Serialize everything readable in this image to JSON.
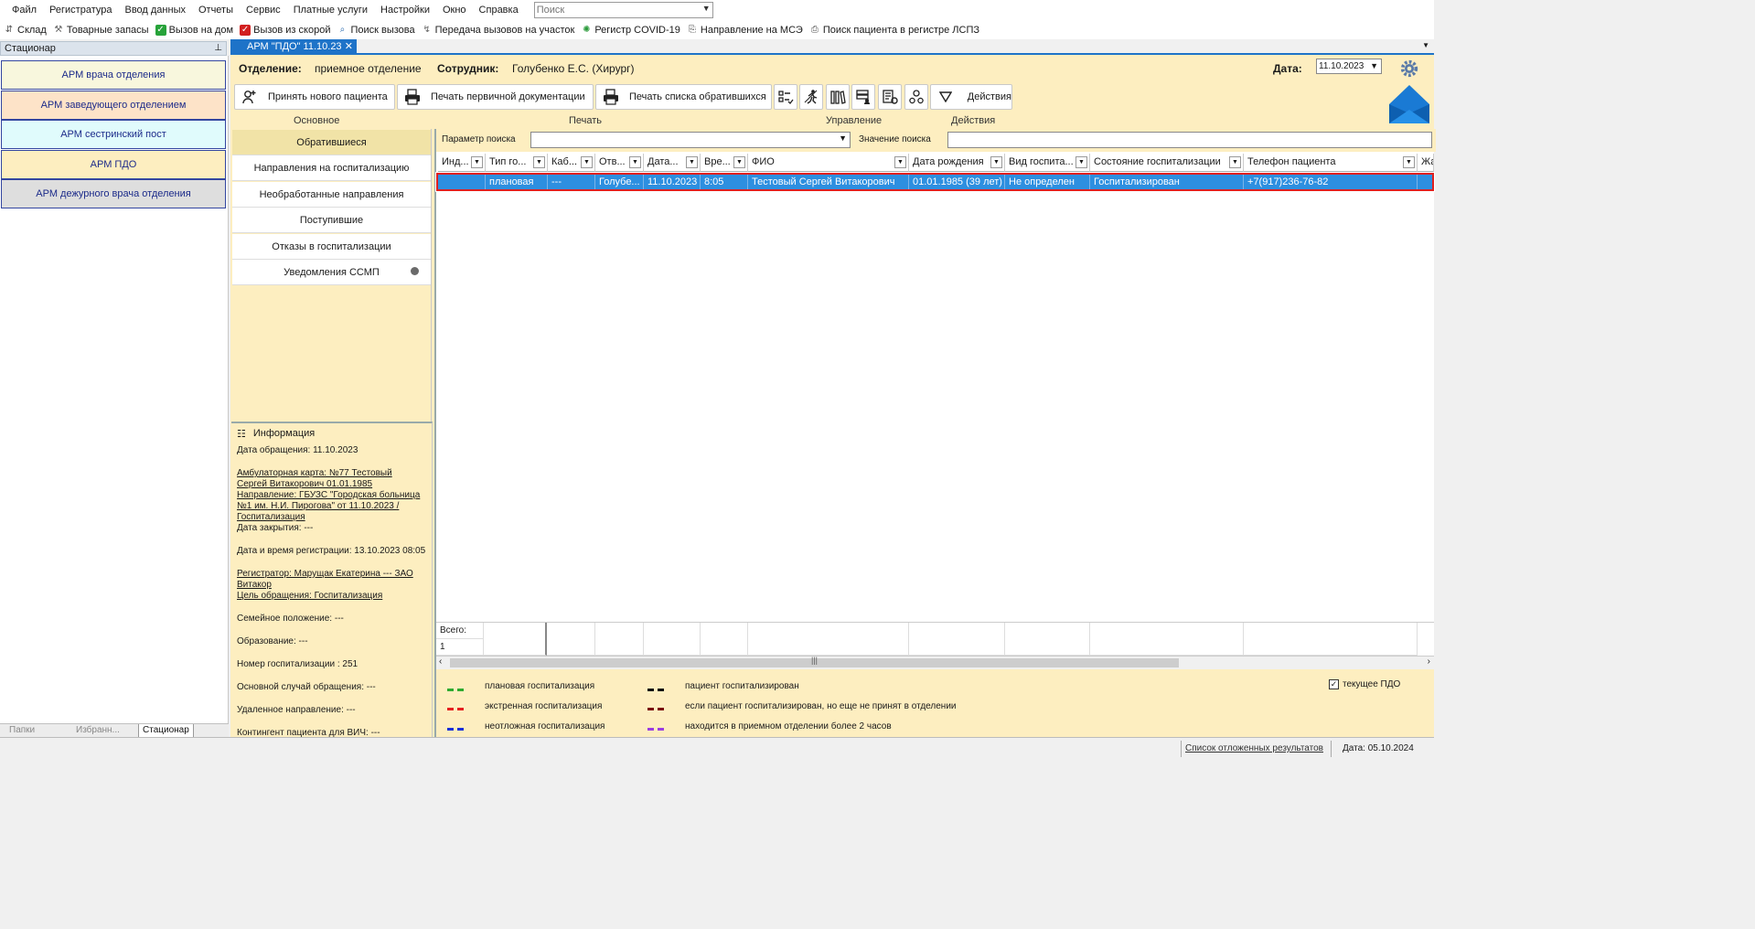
{
  "menu": [
    "Файл",
    "Регистратура",
    "Ввод данных",
    "Отчеты",
    "Сервис",
    "Платные услуги",
    "Настройки",
    "Окно",
    "Справка"
  ],
  "global_search": {
    "placeholder": "Поиск"
  },
  "quick_toolbar": [
    {
      "label": "Склад",
      "icon": "warehouse-icon"
    },
    {
      "label": "Товарные запасы",
      "icon": "stock-icon"
    },
    {
      "label": "Вызов на дом",
      "icon": "home-call-icon"
    },
    {
      "label": "Вызов из скорой",
      "icon": "ambulance-call-icon"
    },
    {
      "label": "Поиск вызова",
      "icon": "call-search-icon"
    },
    {
      "label": "Передача вызовов на участок",
      "icon": "call-transfer-icon"
    },
    {
      "label": "Регистр COVID-19",
      "icon": "covid-icon"
    },
    {
      "label": "Направление на МСЭ",
      "icon": "referral-icon"
    },
    {
      "label": "Поиск пациента в регистре ЛСПЗ",
      "icon": "patient-search-icon"
    }
  ],
  "left_panel": {
    "title": "Стационар",
    "arm_buttons": [
      {
        "label": "АРМ врача отделения",
        "bg": "#f8f7dd"
      },
      {
        "label": "АРМ заведующего отделением",
        "bg": "#fde3c8"
      },
      {
        "label": "АРМ сестринский пост",
        "bg": "#e0fbfc"
      },
      {
        "label": "АРМ ПДО",
        "bg": "#fdeec0"
      },
      {
        "label": "АРМ дежурного врача отделения",
        "bg": "#dedede"
      }
    ],
    "bottom_tabs": [
      "Папки",
      "Избранн...",
      "Стационар"
    ]
  },
  "doc_tab": {
    "label": "АРМ \"ПДО\" 11.10.23"
  },
  "header": {
    "department_label": "Отделение:",
    "department_value": "приемное отделение",
    "employee_label": "Сотрудник:",
    "employee_value": "Голубенко Е.С. (Хирург)",
    "date_label": "Дата:",
    "date_value": "11.10.2023"
  },
  "toolbar": {
    "accept_patient": "Принять нового пациента",
    "print_primary": "Печать первичной документации",
    "print_list": "Печать списка обратившихся",
    "actions": "Действия",
    "groups": {
      "main": "Основное",
      "print": "Печать",
      "manage": "Управление",
      "actions": "Действия"
    }
  },
  "nav": [
    "Обратившиеся",
    "Направления на госпитализацию",
    "Необработанные направления",
    "Поступившие",
    "Отказы в госпитализации",
    "Уведомления ССМП"
  ],
  "search": {
    "param_label": "Параметр поиска",
    "value_label": "Значение поиска"
  },
  "grid": {
    "columns": [
      "Инд...",
      "Тип го...",
      "Каб...",
      "Отв...",
      "Дата...",
      "Вре...",
      "ФИО",
      "Дата рождения",
      "Вид госпита...",
      "Состояние госпитализации",
      "Телефон пациента",
      "Жа"
    ],
    "rows": [
      [
        "",
        "плановая",
        "---",
        "Голубе...",
        "11.10.2023",
        "8:05",
        "Тестовый Сергей Витакорович",
        "01.01.1985 (39 лет)",
        "Не определен",
        "Госпитализирован",
        "+7(917)236-76-82",
        ""
      ]
    ],
    "footer_label": "Всего:",
    "footer_count": "1"
  },
  "info": {
    "title": "Информация",
    "visit_date": "Дата обращения: 11.10.2023",
    "card_1": "Амбулаторная карта: №77 Тестовый ",
    "card_2": "Сергей Витакорович 01.01.1985",
    "ref_1": "Направление: ГБУЗС \"Городская больница",
    "ref_2": "№1 им. Н.И. Пирогова\" от 11.10.2023 /",
    "ref_3": "Госпитализация",
    "close_date": "Дата закрытия: ---",
    "reg_date": "Дата и время регистрации: 13.10.2023 08:05",
    "registrar_1": "Регистратор: Марущак Екатерина --- ЗАО ",
    "registrar_2": "Витакор",
    "purpose": "Цель обращения: Госпитализация",
    "family": "Семейное положение: ---",
    "education": "Образование: ---",
    "hosp_number": "Номер госпитализации : 251",
    "main_case": "Основной случай обращения: ---",
    "remote_ref": "Удаленное направление: ---",
    "contingent": "Контингент пациента для ВИЧ: ---"
  },
  "legend": [
    {
      "color": "#2faa2f",
      "label": "плановая госпитализация"
    },
    {
      "color": "#e52020",
      "label": "экстренная госпитализация"
    },
    {
      "color": "#1a2fd8",
      "label": "неотложная госпитализация"
    },
    {
      "color": "#111111",
      "label": "пациент госпитализирован"
    },
    {
      "color": "#7a1010",
      "label": "если пациент госпитализирован, но еще не принят в  отделении"
    },
    {
      "color": "#9b3ee0",
      "label": "находится в приемном отделении более 2 часов"
    }
  ],
  "current_pdo": "текущее ПДО",
  "statusbar": {
    "postponed": "Список отложенных результатов",
    "date": "Дата: 05.10.2024"
  }
}
